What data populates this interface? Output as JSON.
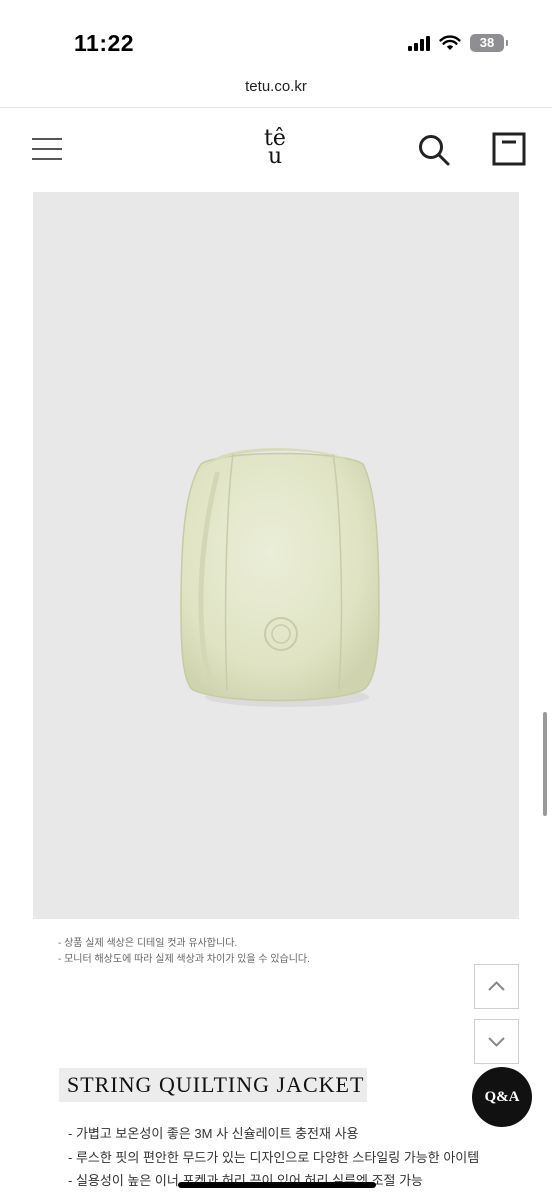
{
  "status_bar": {
    "time": "11:22",
    "battery_level": "38"
  },
  "browser": {
    "url": "tetu.co.kr"
  },
  "header": {
    "logo_line1": "tê",
    "logo_line2": "u",
    "menu_icon": "hamburger-icon",
    "search_icon": "search-icon",
    "cart_icon": "shopping-bag-icon"
  },
  "product": {
    "image_background": "#e8e8e9",
    "notices": [
      "- 상품 실제 색상은 디테일 컷과 유사합니다.",
      "- 모니터 해상도에 따라 실제 색상과 차이가 있을 수 있습니다."
    ],
    "title": "STRING QUILTING JACKET",
    "features": [
      "- 가볍고 보온성이 좋은 3M 사 신슐레이트 충전재 사용",
      "- 루스한 핏의 편안한 무드가 있는 디자인으로 다양한 스타일링 가능한 아이템",
      "- 실용성이 높은 이너 포켓과 허리 끈이 있어 허리 실루엣 조절 가능"
    ]
  },
  "floating": {
    "scroll_up_icon": "chevron-up-icon",
    "scroll_down_icon": "chevron-down-icon",
    "qa_label": "Q&A"
  }
}
